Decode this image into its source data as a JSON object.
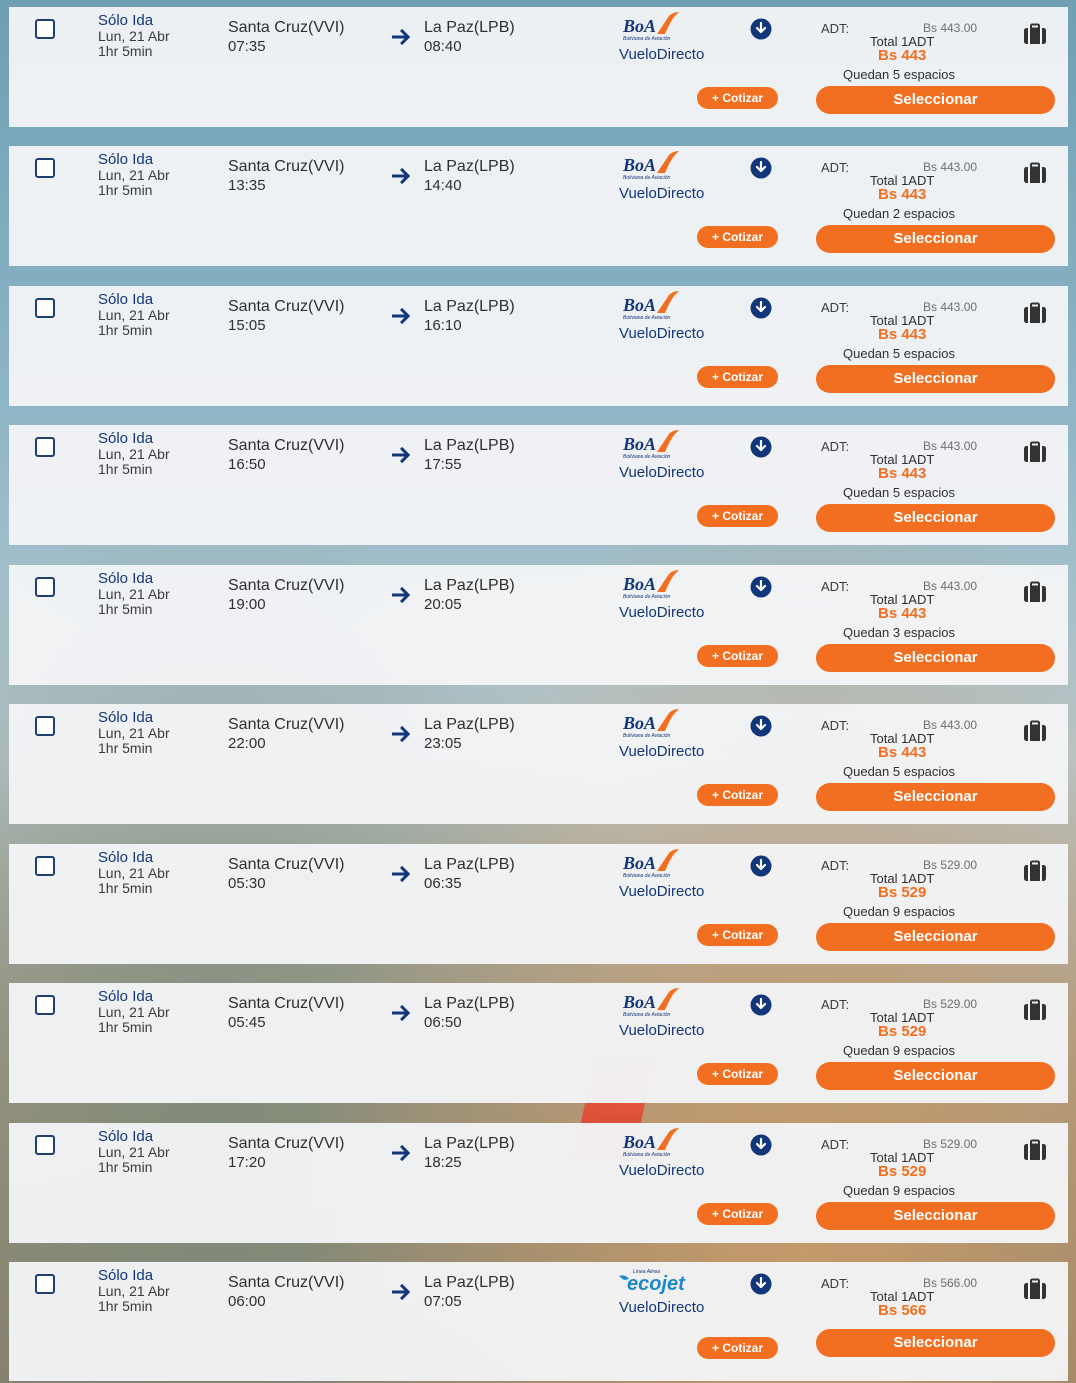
{
  "colors": {
    "accent": "#f26f21",
    "brand_navy": "#12367a",
    "card_bg": "#f3f4f6"
  },
  "flights": [
    {
      "trip_type": "Sólo Ida",
      "date": "Lun, 21 Abr",
      "duration": "1hr 5min",
      "origin": "Santa Cruz(VVI)",
      "depart": "07:35",
      "destination": "La Paz(LPB)",
      "arrive": "08:40",
      "airline": "boa",
      "airline_logo": {
        "name": "BoA",
        "subtitle": "Boliviana de Aviación"
      },
      "flight_type": "VueloDirecto",
      "cotizar_label": "+ Cotizar",
      "adt_label": "ADT:",
      "price_full": "Bs 443.00",
      "total_label": "Total 1ADT",
      "price": "Bs 443",
      "seats": "Quedan 5 espacios",
      "select_label": "Seleccionar"
    },
    {
      "trip_type": "Sólo Ida",
      "date": "Lun, 21 Abr",
      "duration": "1hr 5min",
      "origin": "Santa Cruz(VVI)",
      "depart": "13:35",
      "destination": "La Paz(LPB)",
      "arrive": "14:40",
      "airline": "boa",
      "airline_logo": {
        "name": "BoA",
        "subtitle": "Boliviana de Aviación"
      },
      "flight_type": "VueloDirecto",
      "cotizar_label": "+ Cotizar",
      "adt_label": "ADT:",
      "price_full": "Bs 443.00",
      "total_label": "Total 1ADT",
      "price": "Bs 443",
      "seats": "Quedan 2 espacios",
      "select_label": "Seleccionar"
    },
    {
      "trip_type": "Sólo Ida",
      "date": "Lun, 21 Abr",
      "duration": "1hr 5min",
      "origin": "Santa Cruz(VVI)",
      "depart": "15:05",
      "destination": "La Paz(LPB)",
      "arrive": "16:10",
      "airline": "boa",
      "airline_logo": {
        "name": "BoA",
        "subtitle": "Boliviana de Aviación"
      },
      "flight_type": "VueloDirecto",
      "cotizar_label": "+ Cotizar",
      "adt_label": "ADT:",
      "price_full": "Bs 443.00",
      "total_label": "Total 1ADT",
      "price": "Bs 443",
      "seats": "Quedan 5 espacios",
      "select_label": "Seleccionar"
    },
    {
      "trip_type": "Sólo Ida",
      "date": "Lun, 21 Abr",
      "duration": "1hr 5min",
      "origin": "Santa Cruz(VVI)",
      "depart": "16:50",
      "destination": "La Paz(LPB)",
      "arrive": "17:55",
      "airline": "boa",
      "airline_logo": {
        "name": "BoA",
        "subtitle": "Boliviana de Aviación"
      },
      "flight_type": "VueloDirecto",
      "cotizar_label": "+ Cotizar",
      "adt_label": "ADT:",
      "price_full": "Bs 443.00",
      "total_label": "Total 1ADT",
      "price": "Bs 443",
      "seats": "Quedan 5 espacios",
      "select_label": "Seleccionar"
    },
    {
      "trip_type": "Sólo Ida",
      "date": "Lun, 21 Abr",
      "duration": "1hr 5min",
      "origin": "Santa Cruz(VVI)",
      "depart": "19:00",
      "destination": "La Paz(LPB)",
      "arrive": "20:05",
      "airline": "boa",
      "airline_logo": {
        "name": "BoA",
        "subtitle": "Boliviana de Aviación"
      },
      "flight_type": "VueloDirecto",
      "cotizar_label": "+ Cotizar",
      "adt_label": "ADT:",
      "price_full": "Bs 443.00",
      "total_label": "Total 1ADT",
      "price": "Bs 443",
      "seats": "Quedan 3 espacios",
      "select_label": "Seleccionar"
    },
    {
      "trip_type": "Sólo Ida",
      "date": "Lun, 21 Abr",
      "duration": "1hr 5min",
      "origin": "Santa Cruz(VVI)",
      "depart": "22:00",
      "destination": "La Paz(LPB)",
      "arrive": "23:05",
      "airline": "boa",
      "airline_logo": {
        "name": "BoA",
        "subtitle": "Boliviana de Aviación"
      },
      "flight_type": "VueloDirecto",
      "cotizar_label": "+ Cotizar",
      "adt_label": "ADT:",
      "price_full": "Bs 443.00",
      "total_label": "Total 1ADT",
      "price": "Bs 443",
      "seats": "Quedan 5 espacios",
      "select_label": "Seleccionar"
    },
    {
      "trip_type": "Sólo Ida",
      "date": "Lun, 21 Abr",
      "duration": "1hr 5min",
      "origin": "Santa Cruz(VVI)",
      "depart": "05:30",
      "destination": "La Paz(LPB)",
      "arrive": "06:35",
      "airline": "boa",
      "airline_logo": {
        "name": "BoA",
        "subtitle": "Boliviana de Aviación"
      },
      "flight_type": "VueloDirecto",
      "cotizar_label": "+ Cotizar",
      "adt_label": "ADT:",
      "price_full": "Bs 529.00",
      "total_label": "Total 1ADT",
      "price": "Bs 529",
      "seats": "Quedan 9 espacios",
      "select_label": "Seleccionar"
    },
    {
      "trip_type": "Sólo Ida",
      "date": "Lun, 21 Abr",
      "duration": "1hr 5min",
      "origin": "Santa Cruz(VVI)",
      "depart": "05:45",
      "destination": "La Paz(LPB)",
      "arrive": "06:50",
      "airline": "boa",
      "airline_logo": {
        "name": "BoA",
        "subtitle": "Boliviana de Aviación"
      },
      "flight_type": "VueloDirecto",
      "cotizar_label": "+ Cotizar",
      "adt_label": "ADT:",
      "price_full": "Bs 529.00",
      "total_label": "Total 1ADT",
      "price": "Bs 529",
      "seats": "Quedan 9 espacios",
      "select_label": "Seleccionar"
    },
    {
      "trip_type": "Sólo Ida",
      "date": "Lun, 21 Abr",
      "duration": "1hr 5min",
      "origin": "Santa Cruz(VVI)",
      "depart": "17:20",
      "destination": "La Paz(LPB)",
      "arrive": "18:25",
      "airline": "boa",
      "airline_logo": {
        "name": "BoA",
        "subtitle": "Boliviana de Aviación"
      },
      "flight_type": "VueloDirecto",
      "cotizar_label": "+ Cotizar",
      "adt_label": "ADT:",
      "price_full": "Bs 529.00",
      "total_label": "Total 1ADT",
      "price": "Bs 529",
      "seats": "Quedan 9 espacios",
      "select_label": "Seleccionar"
    },
    {
      "trip_type": "Sólo Ida",
      "date": "Lun, 21 Abr",
      "duration": "1hr 5min",
      "origin": "Santa Cruz(VVI)",
      "depart": "06:00",
      "destination": "La Paz(LPB)",
      "arrive": "07:05",
      "airline": "ecojet",
      "airline_logo": {
        "name": "ecojet",
        "subtitle": "Línea Aérea"
      },
      "flight_type": "VueloDirecto",
      "cotizar_label": "+ Cotizar",
      "adt_label": "ADT:",
      "price_full": "Bs 566.00",
      "total_label": "Total 1ADT",
      "price": "Bs 566",
      "seats": "",
      "select_label": "Seleccionar"
    }
  ]
}
